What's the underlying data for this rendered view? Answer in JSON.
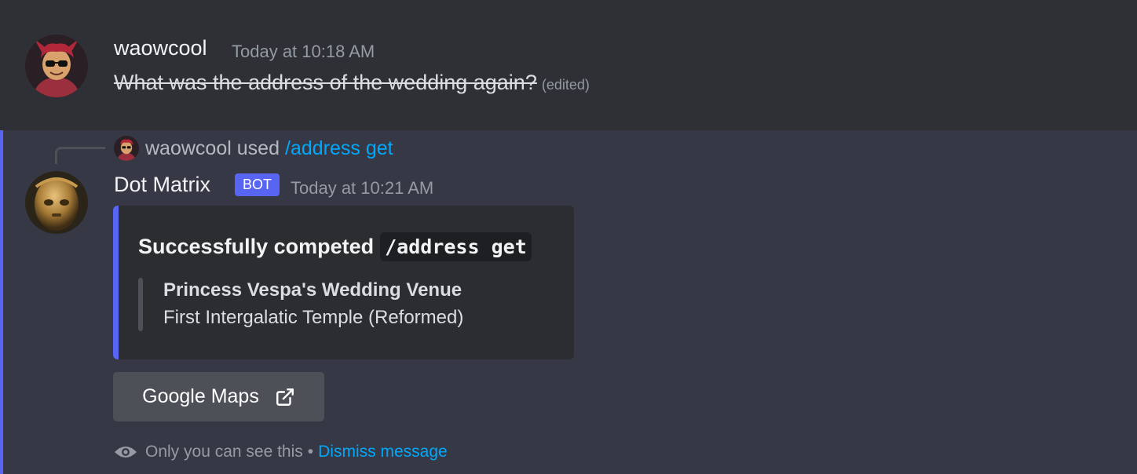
{
  "message1": {
    "author": "waowcool",
    "timestamp": "Today at 10:18 AM",
    "text": "What was the address of the wedding again?",
    "edited_label": "(edited)"
  },
  "message2": {
    "reply": {
      "user": "waowcool",
      "used_label": "used",
      "command": "/address get"
    },
    "author": "Dot Matrix",
    "bot_tag": "BOT",
    "timestamp": "Today at 10:21 AM",
    "embed": {
      "title_prefix": "Successfully competed",
      "title_code": "/address get",
      "field_name": "Princess Vespa's Wedding Venue",
      "field_value": "First Intergalatic Temple (Reformed)",
      "accent_color": "#5865f2"
    },
    "button": {
      "label": "Google Maps",
      "icon": "external-link-icon"
    },
    "ephemeral": {
      "icon": "eye-icon",
      "note": "Only you can see this",
      "separator": "•",
      "dismiss_label": "Dismiss message"
    }
  },
  "colors": {
    "blurple": "#5865f2",
    "link": "#00a8fc",
    "background": "#313338"
  }
}
